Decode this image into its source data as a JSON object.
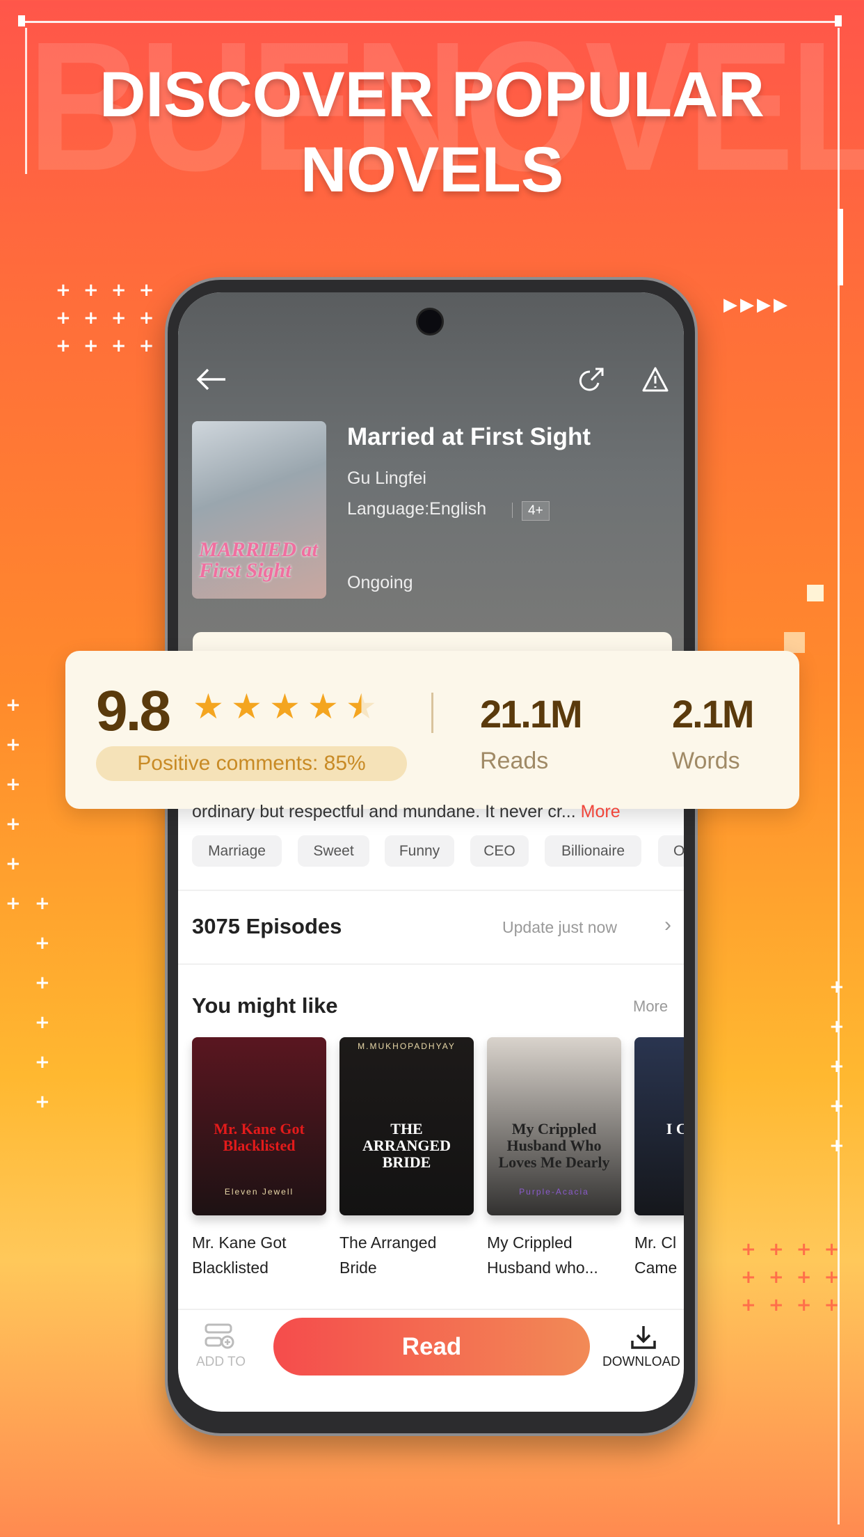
{
  "watermark": "BUENOVELA",
  "headline": {
    "line1": "DISCOVER POPULAR",
    "line2": "NOVELS"
  },
  "book": {
    "title": "Married at First Sight",
    "author": "Gu Lingfei",
    "language": "Language:English",
    "age_rating": "4+",
    "status": "Ongoing",
    "cover_text": "MARRIED at First Sight"
  },
  "rating": {
    "score": "9.8",
    "stars": 4.5,
    "positive": "Positive comments: 85%",
    "reads_value": "21.1M",
    "reads_label": "Reads",
    "words_value": "2.1M",
    "words_label": "Words"
  },
  "description": {
    "text": "ordinary but respectful and mundane. It never cr...",
    "more": "More"
  },
  "tags": [
    "Marriage",
    "Sweet",
    "Funny",
    "CEO",
    "Billionaire",
    "O"
  ],
  "episodes": {
    "count": "3075 Episodes",
    "update": "Update just now",
    "chevron": "›"
  },
  "recommend": {
    "heading": "You might like",
    "more": "More",
    "books": [
      {
        "title_l1": "Mr. Kane Got",
        "title_l2": "Blacklisted",
        "cover": "Mr. Kane Got Blacklisted",
        "author": "Eleven Jewell",
        "bg": "#5a1620"
      },
      {
        "title_l1": "The Arranged",
        "title_l2": "Bride",
        "cover": "THE ARRANGED BRIDE",
        "author": "M.MUKHOPADHYAY",
        "bg": "#1d1a19"
      },
      {
        "title_l1": "My Crippled",
        "title_l2": "Husband who...",
        "cover": "My Crippled Husband Who Loves Me Dearly",
        "author": "Purple-Acacia",
        "bg": "#d9d3cc"
      },
      {
        "title_l1": "Mr. Cl",
        "title_l2": "Came",
        "cover": "I CAME B",
        "author": "",
        "bg": "#2a3550"
      }
    ]
  },
  "bottom": {
    "add_label": "ADD TO",
    "read_label": "Read",
    "download_label": "DOWNLOAD"
  },
  "colors": {
    "accent": "#f4584c",
    "star": "#f4a520",
    "rating_text": "#5a3a0c",
    "more": "#f0453a"
  }
}
